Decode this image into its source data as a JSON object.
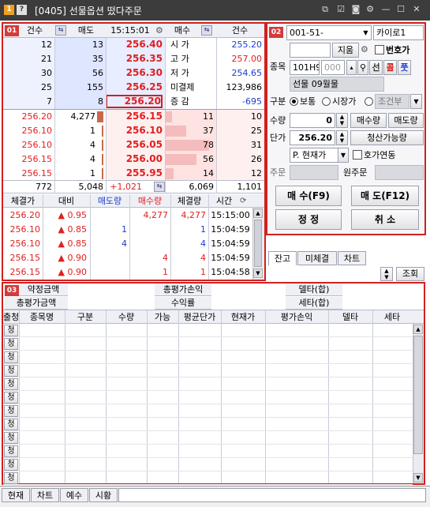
{
  "window": {
    "title": "[0405] 선물옵션 떴다주문",
    "badge1": "1",
    "badge2": "?"
  },
  "orderbook": {
    "badge": "01",
    "headers": {
      "cnt_left": "건수",
      "sell": "매도",
      "time": "15:15:01",
      "buy": "매수",
      "cnt_right": "건수"
    },
    "ask_rows": [
      {
        "cnt": "12",
        "qty": "13",
        "price": "256.40",
        "label": "시  가",
        "val": "255.20",
        "vcolor": "blue"
      },
      {
        "cnt": "21",
        "qty": "35",
        "price": "256.35",
        "label": "고  가",
        "val": "257.00",
        "vcolor": "red"
      },
      {
        "cnt": "30",
        "qty": "56",
        "price": "256.30",
        "label": "저  가",
        "val": "254.65",
        "vcolor": "blue"
      },
      {
        "cnt": "25",
        "qty": "155",
        "price": "256.25",
        "label": "미결제",
        "val": "123,986",
        "vcolor": "black"
      },
      {
        "cnt": "7",
        "qty": "8",
        "price": "256.20",
        "label": "증  감",
        "val": "-695",
        "vcolor": "blue"
      }
    ],
    "bid_rows": [
      {
        "p1": "256.20",
        "q1": "4,277",
        "price": "256.15",
        "bq": "11",
        "bc": "10"
      },
      {
        "p1": "256.10",
        "q1": "1",
        "price": "256.10",
        "bq": "37",
        "bc": "25"
      },
      {
        "p1": "256.10",
        "q1": "4",
        "price": "256.05",
        "bq": "78",
        "bc": "31"
      },
      {
        "p1": "256.15",
        "q1": "4",
        "price": "256.00",
        "bq": "56",
        "bc": "26"
      },
      {
        "p1": "256.15",
        "q1": "1",
        "price": "255.95",
        "bq": "14",
        "bc": "12"
      }
    ],
    "totals": {
      "cnt": "772",
      "qty": "5,048",
      "diff": "+1,021",
      "bq": "6,069",
      "bc": "1,101"
    },
    "trade_headers": [
      "체결가",
      "대비",
      "매도량",
      "매수량",
      "체결량",
      "시간"
    ],
    "trades": [
      {
        "price": "256.20",
        "diff": "▲ 0.95",
        "sellq": "",
        "buyq": "4,277",
        "vol": "4,277",
        "time": "15:15:00"
      },
      {
        "price": "256.10",
        "diff": "▲ 0.85",
        "sellq": "1",
        "buyq": "",
        "vol": "1",
        "time": "15:04:59"
      },
      {
        "price": "256.10",
        "diff": "▲ 0.85",
        "sellq": "4",
        "buyq": "",
        "vol": "4",
        "time": "15:04:59"
      },
      {
        "price": "256.15",
        "diff": "▲ 0.90",
        "sellq": "",
        "buyq": "4",
        "vol": "4",
        "time": "15:04:59"
      },
      {
        "price": "256.15",
        "diff": "▲ 0.90",
        "sellq": "",
        "buyq": "1",
        "vol": "1",
        "time": "15:04:58"
      }
    ]
  },
  "order": {
    "badge": "02",
    "account": "001-51-",
    "account_name": "카이로1",
    "clear_label": "지움",
    "pw_label": "번호가",
    "code_label": "종목",
    "code": "101H9",
    "code2": "000",
    "btn_seon": "선",
    "btn_kol": "콜",
    "btn_put": "풋",
    "item_name": "선물 09월물",
    "type_label": "구분",
    "type_opts": [
      "보통",
      "시장가",
      "조건부"
    ],
    "qty_label": "수량",
    "qty": "0",
    "sellable": "매수량",
    "buyable": "매도량",
    "price_label": "단가",
    "price": "256.20",
    "liq_label": "청산가능량",
    "ptype": "P. 현재가",
    "hoga_link": "호가연동",
    "orig_label": "주문",
    "orig2_label": "원주문",
    "buy_btn": "매 수(F9)",
    "sell_btn": "매  도(F12)",
    "modify_btn": "정  정",
    "cancel_btn": "취  소"
  },
  "balance": {
    "tabs": [
      "잔고",
      "미체결",
      "차트"
    ],
    "query": "조회",
    "badge": "03",
    "summary": [
      {
        "k1": "약정금액",
        "k2": "총평가손익",
        "k3": "델타(합)"
      },
      {
        "k1": "총평가금액",
        "k2": "수익률",
        "k3": "세타(합)"
      }
    ],
    "columns": [
      "종목명",
      "구분",
      "수량",
      "가능",
      "평균단가",
      "현재가",
      "평가손익",
      "델타",
      "세타"
    ],
    "side_header": "출청",
    "row_mark": "청",
    "row_count": 12
  },
  "statusbar": {
    "tabs": [
      "현재",
      "차트",
      "예수",
      "시황"
    ]
  }
}
